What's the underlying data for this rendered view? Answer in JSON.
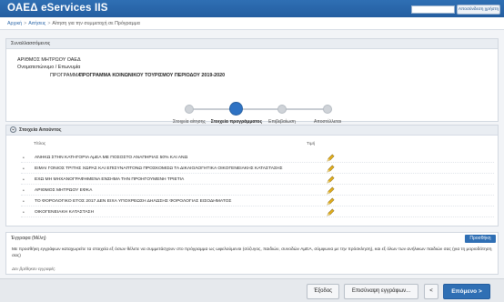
{
  "header": {
    "app_title": "ΟΑΕΔ eServices IIS",
    "user_name": "",
    "logout_label": "Αποσύνδεση χρήστη"
  },
  "breadcrumb": {
    "items": [
      "Αρχική",
      "Αιτήσεις",
      "Αίτηση για την συμμετοχή σε Πρόγραμμα"
    ]
  },
  "info_panel": {
    "title": "Συναλλασσόμενος",
    "registry_label": "ΑΡΙΘΜΟΣ ΜΗΤΡΩΟΥ ΟΑΕΔ",
    "name_label": "Ονοματεπώνυμο / Επωνυμία",
    "program_label": "ΠΡΟΓΡΑΜΜΑ",
    "program_value": "ΠΡΟΓΡΑΜΜΑ ΚΟΙΝΩΝΙΚΟΥ ΤΟΥΡΙΣΜΟΥ ΠΕΡΙΟΔΟΥ 2019-2020"
  },
  "steps": [
    {
      "label": "Στοιχεία αίτησης",
      "active": false
    },
    {
      "label": "Στοιχεία προγράμματος",
      "active": true
    },
    {
      "label": "Επιβεβαίωση",
      "active": false
    },
    {
      "label": "Αποστέλλεται",
      "active": false
    }
  ],
  "elements_panel": {
    "title": "Στοιχεία Αιτούντος",
    "col_title": "Τίτλος",
    "col_value": "Τιμή",
    "rows": [
      "ΑΝΗΚΩ ΣΤΗΝ ΚΑΤΗΓΟΡΙΑ ΑμΕΑ ΜΕ ΠΟΣΟΣΤΟ ΑΝΑΠΗΡΙΑΣ 50% ΚΑΙ ΑΝΩ",
      "ΕΙΜΑΙ ΓΟΝΙΟΣ ΤΡΙΤΗΣ ΧΩΡΑΣ ΚΑΙ ΕΠΙΣΥΝΑΠΤΟΝΩ ΠΡΟΣΚΟΜΙΣΩ ΤΑ ΔΙΚΑΙΟΛΟΓΗΤΙΚΑ ΟΙΚΟΓΕΝΕΙΑΚΗΣ ΚΑΤΑΣΤΑΣΗΣ",
      "ΕΧΩ ΜΗ ΜΗΧΑΝΟΓΡΑΦΗΜΕΝΑ ΕΝΣΗΜΑ ΤΗΝ ΠΡΟΗΓΟΥΜΕΝΗ ΤΡΙΕΤΙΑ",
      "ΑΡΙΘΜΟΣ ΜΗΤΡΩΟΥ ΕΦΚΑ",
      "ΤΟ ΦΟΡΟΛΟΓΙΚΟ ΕΤΟΣ 2017 ΔΕΝ ΕΙΧΑ ΥΠΟΧΡΕΩΣΗ ΔΗΛΩΣΗΣ ΦΟΡΟΛΟΓΙΑΣ ΕΙΣΟΔΗΜΑΤΟΣ",
      "ΟΙΚΟΓΕΝΕΙΑΚΗ ΚΑΤΑΣΤΑΣΗ"
    ]
  },
  "docs_panel": {
    "title": "Έγγραφα (Μέλη)",
    "add_label": "Προσθήκη",
    "description": "Με προσθήκη εγγράφων καταχωρείτε τα στοιχεία εξ όσων θέλετε να συμμετάσχουν στο πρόγραμμα ως ωφελούμενοι (σύζυγος, παιδιών, συνοδών ΑμΕΑ, σύμφωνα με την πρόσκληση), και εξ όλων των ανήλικων παιδιών σας (για τη μοριοδότηση σας)",
    "empty_text": "Δεν βρέθηκαν εγγραφές."
  },
  "footer": {
    "exit_label": "Έξοδος",
    "review_docs_label": "Επισύναψη εγγράφων...",
    "back_label": "<",
    "next_label": "Επόμενο >"
  }
}
